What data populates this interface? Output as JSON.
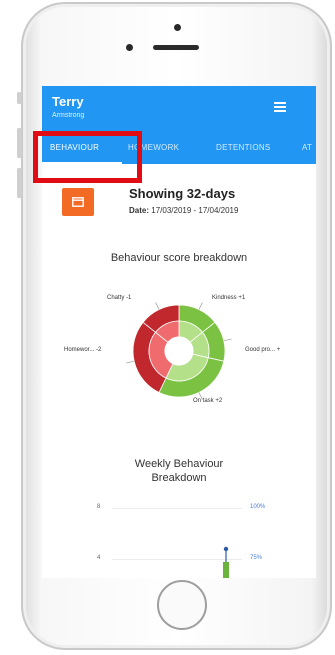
{
  "header": {
    "first_name": "Terry",
    "last_name": "Armstrong"
  },
  "tabs": [
    {
      "label": "BEHAVIOUR",
      "active": true
    },
    {
      "label": "HOMEWORK",
      "active": false
    },
    {
      "label": "DETENTIONS",
      "active": false
    },
    {
      "label": "AT",
      "active": false
    }
  ],
  "summary": {
    "showing": "Showing 32-days",
    "date_label": "Date:",
    "date_range": "17/03/2019 - 17/04/2019"
  },
  "breakdown": {
    "title": "Behaviour score breakdown"
  },
  "weekly": {
    "title_line1": "Weekly Behaviour",
    "title_line2": "Breakdown",
    "left_ticks": [
      "8",
      "4"
    ],
    "right_ticks": [
      "100%",
      "75%"
    ]
  },
  "chart_data": {
    "type": "pie",
    "categories": [
      "Chatty",
      "Kindness",
      "Good pro...",
      "On task",
      "Homewor..."
    ],
    "labels": [
      "Chatty -1",
      "Kindness +1",
      "Good pro... +",
      "On task +2",
      "Homewor... -2"
    ],
    "values": [
      -1,
      1,
      1,
      2,
      -2
    ],
    "colors": {
      "negative": "#c0282d",
      "negative_light": "#ef6b6e",
      "positive": "#7cc242",
      "positive_light": "#b4e08a"
    }
  },
  "colors": {
    "accent": "#2196f3",
    "calendar_button": "#f26a23",
    "highlight": "#e10b14"
  }
}
